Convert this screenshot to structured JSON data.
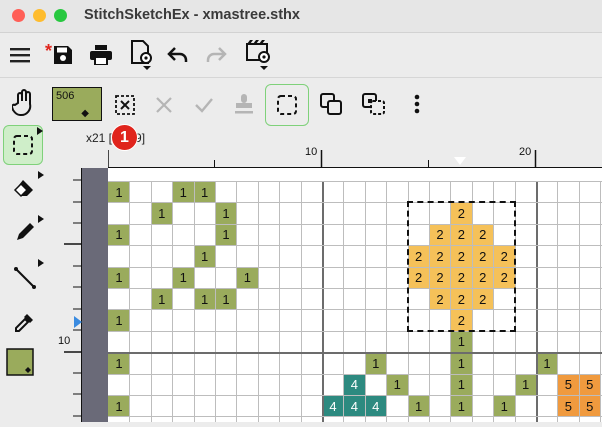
{
  "window": {
    "title": "StitchSketchEx - xmastree.sthx",
    "buttons": [
      "close",
      "minimize",
      "zoom"
    ]
  },
  "toolbar_main": {
    "items": [
      {
        "name": "menu-icon"
      },
      {
        "name": "save-icon",
        "modified_mark": "*"
      },
      {
        "name": "print-icon"
      },
      {
        "name": "document-settings-icon"
      },
      {
        "name": "undo-icon"
      },
      {
        "name": "redo-icon"
      },
      {
        "name": "movie-settings-icon"
      }
    ]
  },
  "palette": {
    "current_color_code": "506",
    "current_color": "#9aab5c",
    "symbol": "◆"
  },
  "selection_toolbar": {
    "items": [
      "clear-selection-icon",
      "cancel-icon",
      "confirm-icon",
      "stamp-icon",
      "select-rect-icon",
      "copy-icon",
      "duplicate-icon",
      "more-icon"
    ]
  },
  "status": {
    "coord_text": "x21 [",
    "coord_tail": "9]",
    "badge": "1"
  },
  "ruler": {
    "top_labels": [
      "10",
      "20"
    ],
    "left_labels": [
      "10"
    ]
  },
  "colors": {
    "green": "#9aab5c",
    "orange": "#f5c159",
    "teal": "#2d8a80",
    "dark_orange": "#f09a3e",
    "active_tool": "#cfeec9",
    "active_border": "#7fd17a"
  },
  "grid_cells": [
    {
      "r": 0,
      "c": 0,
      "v": "1",
      "t": "g"
    },
    {
      "r": 0,
      "c": 3,
      "v": "1",
      "t": "g"
    },
    {
      "r": 0,
      "c": 4,
      "v": "1",
      "t": "g"
    },
    {
      "r": 1,
      "c": 2,
      "v": "1",
      "t": "g"
    },
    {
      "r": 1,
      "c": 5,
      "v": "1",
      "t": "g"
    },
    {
      "r": 1,
      "c": 16,
      "v": "2",
      "t": "o"
    },
    {
      "r": 2,
      "c": 0,
      "v": "1",
      "t": "g"
    },
    {
      "r": 2,
      "c": 5,
      "v": "1",
      "t": "g"
    },
    {
      "r": 2,
      "c": 15,
      "v": "2",
      "t": "o"
    },
    {
      "r": 2,
      "c": 16,
      "v": "2",
      "t": "o"
    },
    {
      "r": 2,
      "c": 17,
      "v": "2",
      "t": "o"
    },
    {
      "r": 3,
      "c": 4,
      "v": "1",
      "t": "g"
    },
    {
      "r": 3,
      "c": 14,
      "v": "2",
      "t": "o"
    },
    {
      "r": 3,
      "c": 15,
      "v": "2",
      "t": "o"
    },
    {
      "r": 3,
      "c": 16,
      "v": "2",
      "t": "o"
    },
    {
      "r": 3,
      "c": 17,
      "v": "2",
      "t": "o"
    },
    {
      "r": 3,
      "c": 18,
      "v": "2",
      "t": "o"
    },
    {
      "r": 4,
      "c": 0,
      "v": "1",
      "t": "g"
    },
    {
      "r": 4,
      "c": 3,
      "v": "1",
      "t": "g"
    },
    {
      "r": 4,
      "c": 6,
      "v": "1",
      "t": "g"
    },
    {
      "r": 4,
      "c": 14,
      "v": "2",
      "t": "o"
    },
    {
      "r": 4,
      "c": 15,
      "v": "2",
      "t": "o"
    },
    {
      "r": 4,
      "c": 16,
      "v": "2",
      "t": "o"
    },
    {
      "r": 4,
      "c": 17,
      "v": "2",
      "t": "o"
    },
    {
      "r": 4,
      "c": 18,
      "v": "2",
      "t": "o"
    },
    {
      "r": 5,
      "c": 2,
      "v": "1",
      "t": "g"
    },
    {
      "r": 5,
      "c": 4,
      "v": "1",
      "t": "g"
    },
    {
      "r": 5,
      "c": 5,
      "v": "1",
      "t": "g"
    },
    {
      "r": 5,
      "c": 15,
      "v": "2",
      "t": "o"
    },
    {
      "r": 5,
      "c": 16,
      "v": "2",
      "t": "o"
    },
    {
      "r": 5,
      "c": 17,
      "v": "2",
      "t": "o"
    },
    {
      "r": 6,
      "c": 0,
      "v": "1",
      "t": "g"
    },
    {
      "r": 6,
      "c": 16,
      "v": "2",
      "t": "o"
    },
    {
      "r": 7,
      "c": 16,
      "v": "1",
      "t": "g"
    },
    {
      "r": 8,
      "c": 0,
      "v": "1",
      "t": "g"
    },
    {
      "r": 8,
      "c": 12,
      "v": "1",
      "t": "g"
    },
    {
      "r": 8,
      "c": 16,
      "v": "1",
      "t": "g"
    },
    {
      "r": 8,
      "c": 20,
      "v": "1",
      "t": "g"
    },
    {
      "r": 9,
      "c": 11,
      "v": "4",
      "t": "t"
    },
    {
      "r": 9,
      "c": 13,
      "v": "1",
      "t": "g"
    },
    {
      "r": 9,
      "c": 16,
      "v": "1",
      "t": "g"
    },
    {
      "r": 9,
      "c": 19,
      "v": "1",
      "t": "g"
    },
    {
      "r": 9,
      "c": 21,
      "v": "5",
      "t": "d"
    },
    {
      "r": 9,
      "c": 22,
      "v": "5",
      "t": "d"
    },
    {
      "r": 10,
      "c": 0,
      "v": "1",
      "t": "g"
    },
    {
      "r": 10,
      "c": 10,
      "v": "4",
      "t": "t"
    },
    {
      "r": 10,
      "c": 11,
      "v": "4",
      "t": "t"
    },
    {
      "r": 10,
      "c": 12,
      "v": "4",
      "t": "t"
    },
    {
      "r": 10,
      "c": 14,
      "v": "1",
      "t": "g"
    },
    {
      "r": 10,
      "c": 16,
      "v": "1",
      "t": "g"
    },
    {
      "r": 10,
      "c": 18,
      "v": "1",
      "t": "g"
    },
    {
      "r": 10,
      "c": 21,
      "v": "5",
      "t": "d"
    },
    {
      "r": 10,
      "c": 22,
      "v": "5",
      "t": "d"
    }
  ]
}
